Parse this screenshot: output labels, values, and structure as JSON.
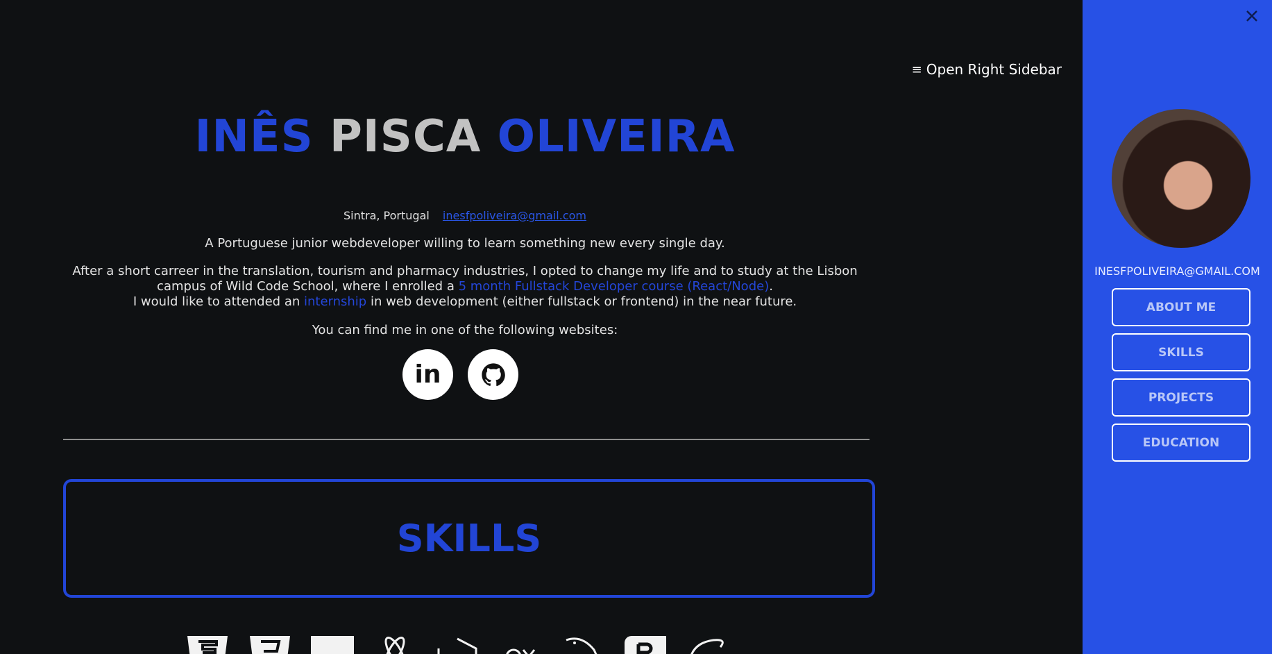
{
  "header": {
    "open_sidebar_label": "Open Right Sidebar",
    "open_sidebar_icon": "≡"
  },
  "hero": {
    "first_name": "INÊS",
    "middle_name": "PISCA",
    "last_name": "OLIVEIRA",
    "location": "Sintra, Portugal",
    "email": "inesfpoliveira@gmail.com"
  },
  "intro": {
    "tagline": "A Portuguese junior webdeveloper willing to learn something new every single day.",
    "para_part1": "After a short carreer in the translation, tourism and pharmacy industries, I opted to change my life and to study at the Lisbon campus of Wild Code School, where I enrolled a ",
    "para_link1": "5 month Fullstack Developer course (React/Node)",
    "para_part2": ".",
    "para_part3": "I would like to attended an ",
    "para_link2": "internship",
    "para_part4": " in web development (either fullstack or frontend) in the near future.",
    "find_me": "You can find me in one of the following websites:"
  },
  "socials": [
    {
      "name": "linkedin-icon",
      "label": "in"
    },
    {
      "name": "github-icon"
    }
  ],
  "skills": {
    "title": "SKILLS"
  },
  "sidebar": {
    "email": "INESFPOLIVEIRA@GMAIL.COM",
    "buttons": [
      "ABOUT ME",
      "SKILLS",
      "PROJECTS",
      "EDUCATION"
    ]
  },
  "colors": {
    "accent": "#2245d6",
    "sidebar_bg": "#2751e6",
    "page_bg": "#0f1113"
  }
}
